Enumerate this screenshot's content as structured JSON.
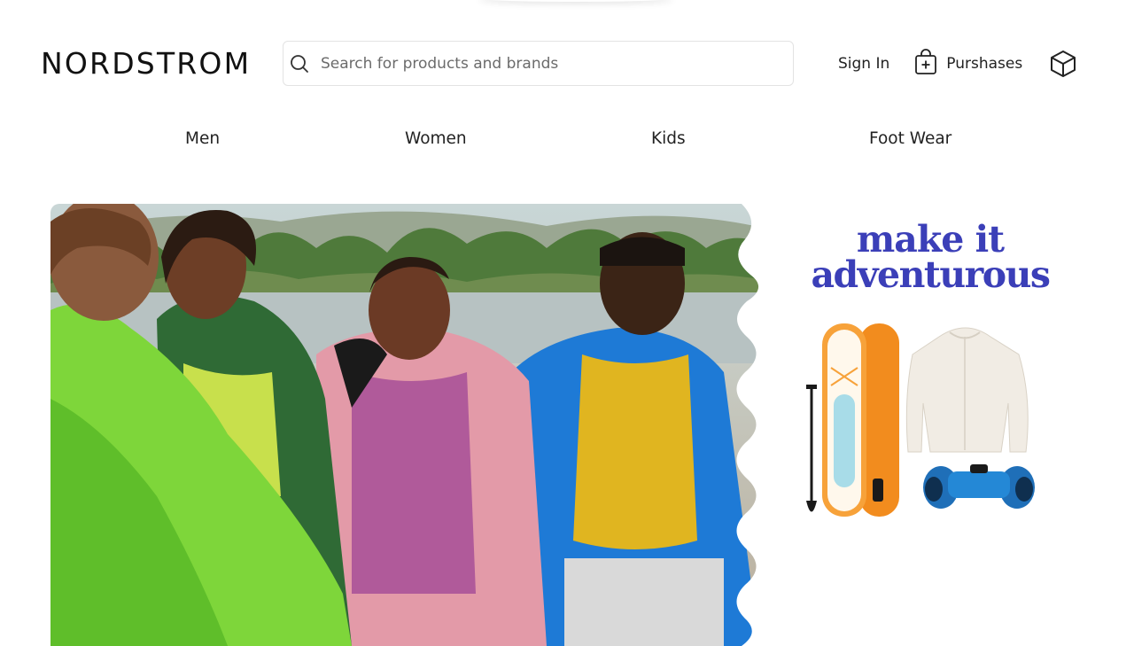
{
  "brand": {
    "logo_text": "NORDSTROM"
  },
  "search": {
    "placeholder": "Search for products and brands",
    "value": "",
    "icon": "search-icon"
  },
  "header_actions": {
    "sign_in_label": "Sign In",
    "purchases_label": "Purshases",
    "purchases_icon": "shopping-bag-plus-icon",
    "package_icon": "package-box-icon"
  },
  "nav": {
    "items": [
      {
        "label": "Men"
      },
      {
        "label": "Women"
      },
      {
        "label": "Kids"
      },
      {
        "label": "Foot Wear"
      }
    ]
  },
  "hero": {
    "image": "four-friends-laughing-in-outerwear-photo"
  },
  "promo": {
    "headline_line1": "make it",
    "headline_line2": "adventurous",
    "accent_color": "#3b3fb8",
    "products": [
      "paddle-board-with-paddle",
      "sherpa-puffer-jacket",
      "blue-binoculars"
    ]
  }
}
